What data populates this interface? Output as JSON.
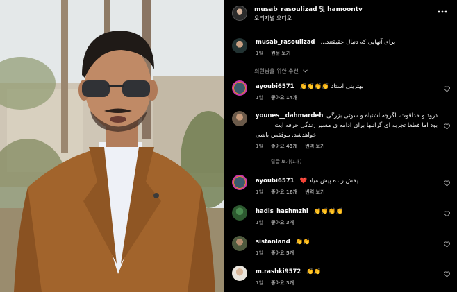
{
  "header": {
    "title": "musab_rasoulizad 및 hamoontv",
    "subtitle": "오리지널 오디오"
  },
  "caption": {
    "username": "musab_rasoulizad",
    "text": "برای آنهایی که دنبال حقیقتند...",
    "time": "1일",
    "action": "원문 보기"
  },
  "section_label": "회원님을 위한 추천",
  "comments": [
    {
      "username": "ayoubi6571",
      "text": "بهترینی استاد 👏👏👏👏",
      "time": "1일",
      "likes": "좋아요 14개",
      "action": ""
    },
    {
      "username": "younes__dahmardeh",
      "lines": [
        "درود و خداقوت، اگرچه اشتباه و سوتی بزرگی",
        "بود اما قطعا تجربه ای گرانبها برای ادامه ی مسیر زندگی حرفه ایت",
        "خواهدشد. موفقص باشی"
      ],
      "time": "1일",
      "likes": "좋아요 43개",
      "action": "번역 보기"
    },
    {
      "username": "ayoubi6571",
      "text": "پخش زنده پیش میاد ❤️",
      "time": "1일",
      "likes": "좋아요 16개",
      "action": "번역 보기"
    },
    {
      "username": "hadis_hashmzhi",
      "text": "👏👏👏👏",
      "time": "1일",
      "likes": "좋아요 3개",
      "action": ""
    },
    {
      "username": "sistanland",
      "text": "👏👏",
      "time": "1일",
      "likes": "좋아요 5개",
      "action": ""
    },
    {
      "username": "m.rashki9572",
      "text": "👏👏",
      "time": "1일",
      "likes": "좋아요 3개",
      "action": ""
    }
  ],
  "replies_link": "답글 보기(1개)",
  "colors": {
    "background": "#000000",
    "muted_text": "#a8a8a8",
    "suit": "#a2642c"
  },
  "icons": {
    "more": "more-horizontal-icon",
    "heart": "heart-outline-icon",
    "chevron": "chevron-down-icon"
  }
}
